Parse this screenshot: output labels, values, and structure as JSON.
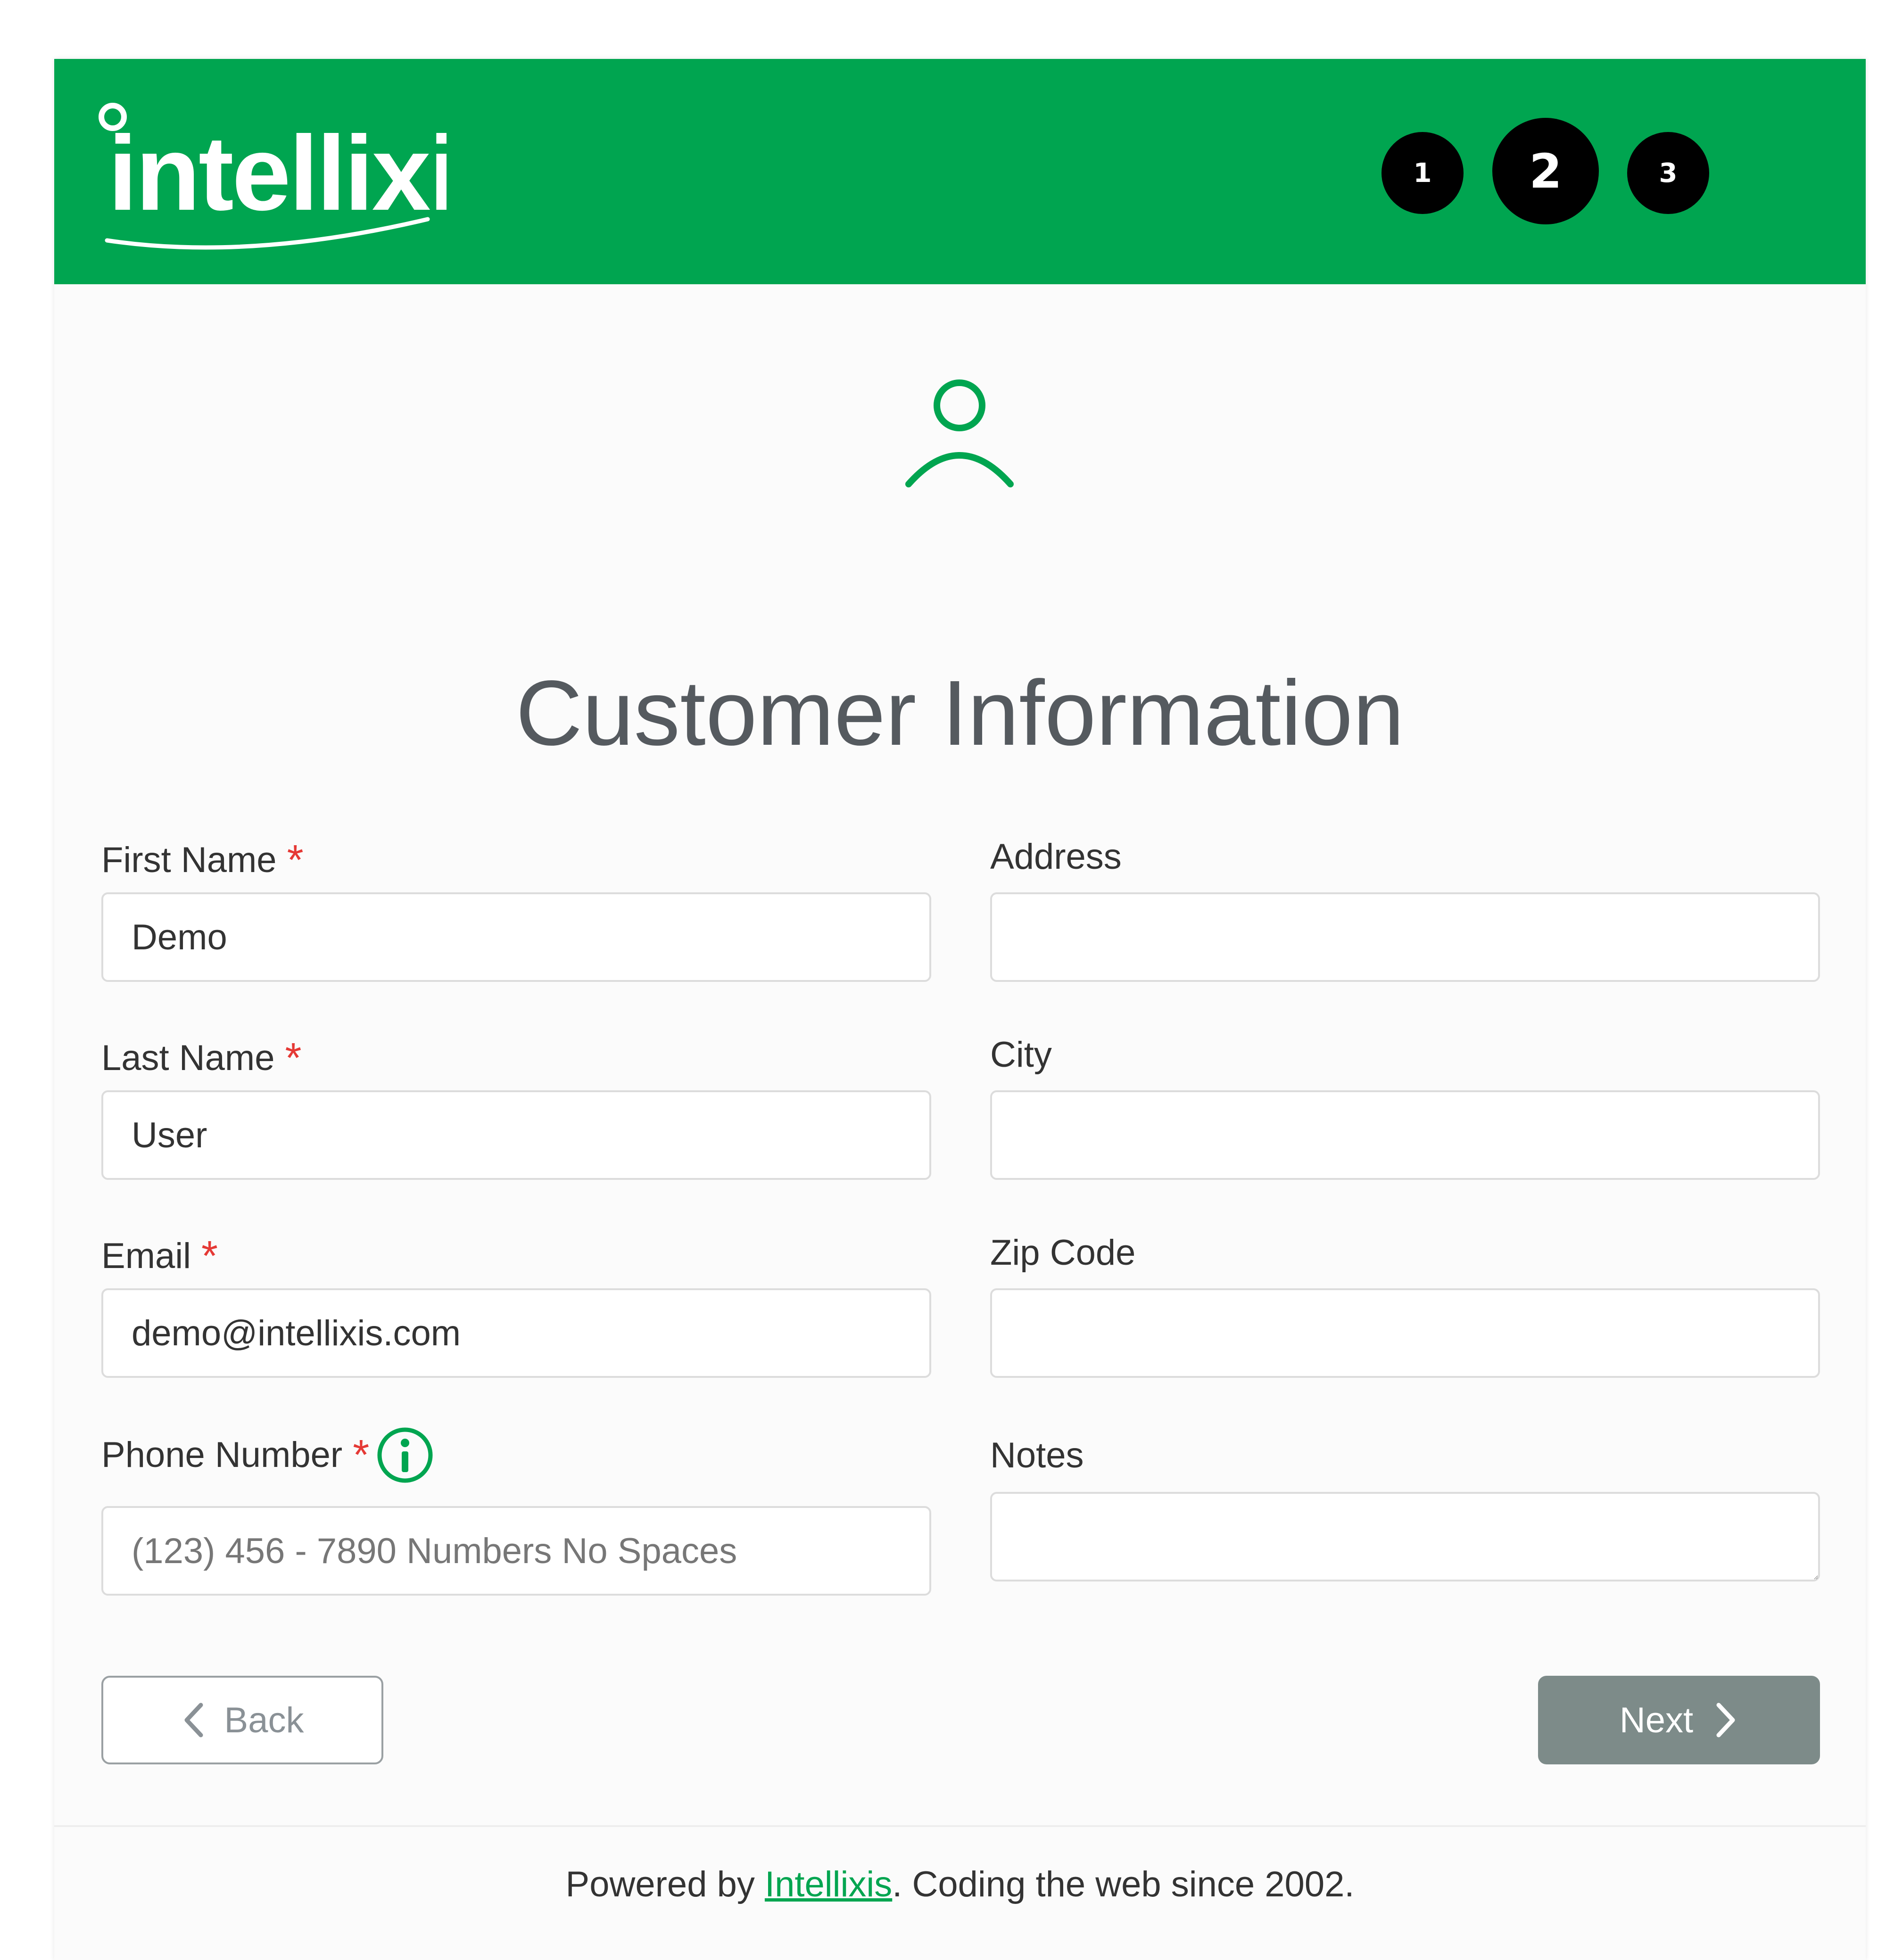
{
  "brand": {
    "name": "intellixis",
    "color": "#00a550"
  },
  "steps": [
    "1",
    "2",
    "3"
  ],
  "current_step": 2,
  "page": {
    "icon": "user-icon",
    "title": "Customer Information"
  },
  "form": {
    "first_name": {
      "label": "First Name",
      "value": "Demo",
      "required": "*"
    },
    "last_name": {
      "label": "Last Name",
      "value": "User",
      "required": "*"
    },
    "email": {
      "label": "Email",
      "value": "demo@intellixis.com",
      "required": "*"
    },
    "phone": {
      "label": "Phone Number",
      "value": "",
      "placeholder": "(123) 456 - 7890 Numbers No Spaces",
      "required": "*",
      "info_icon": "info-icon"
    },
    "address": {
      "label": "Address",
      "value": ""
    },
    "city": {
      "label": "City",
      "value": ""
    },
    "zip": {
      "label": "Zip Code",
      "value": ""
    },
    "notes": {
      "label": "Notes",
      "value": ""
    }
  },
  "buttons": {
    "back": "Back",
    "next": "Next"
  },
  "footer": {
    "prefix": "Powered by ",
    "link": "Intellixis",
    "suffix": ". Coding the web since 2002."
  }
}
